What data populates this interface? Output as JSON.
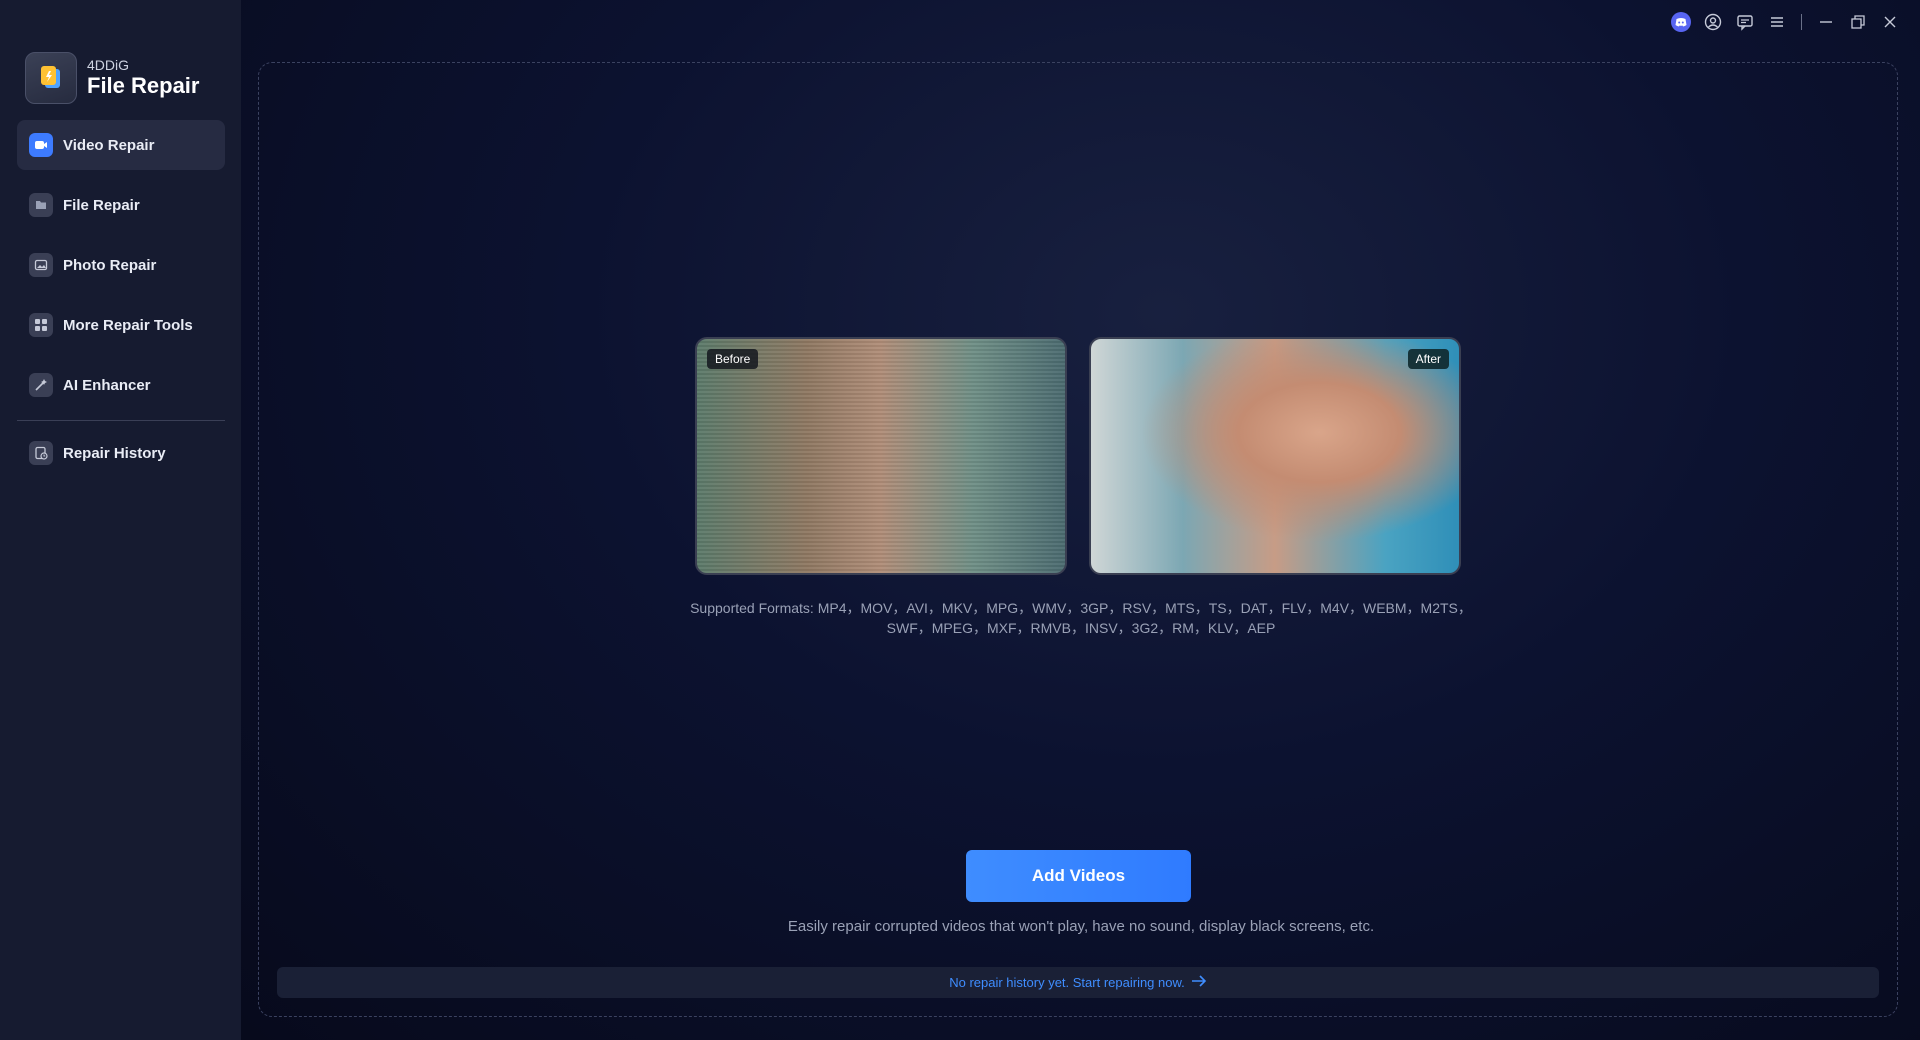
{
  "brand": {
    "company": "4DDiG",
    "product": "File Repair"
  },
  "sidebar": {
    "items": [
      {
        "label": "Video Repair",
        "icon": "video-icon",
        "active": true
      },
      {
        "label": "File Repair",
        "icon": "file-icon",
        "active": false
      },
      {
        "label": "Photo Repair",
        "icon": "photo-icon",
        "active": false
      },
      {
        "label": "More Repair Tools",
        "icon": "grid-icon",
        "active": false
      },
      {
        "label": "AI Enhancer",
        "icon": "magic-wand-icon",
        "active": false
      }
    ],
    "history": {
      "label": "Repair History",
      "icon": "history-icon"
    }
  },
  "titlebar": {
    "icons": [
      "discord-icon",
      "account-icon",
      "feedback-icon",
      "menu-icon",
      "minimize-icon",
      "restore-icon",
      "close-icon"
    ]
  },
  "preview": {
    "before_label": "Before",
    "after_label": "After"
  },
  "formats": {
    "prefix": "Supported Formats:",
    "line1": "MP4，MOV，AVI，MKV，MPG，WMV，3GP，RSV，MTS，TS，DAT，FLV，M4V，WEBM，M2TS，",
    "line2": "SWF，MPEG，MXF，RMVB，INSV，3G2，RM，KLV，AEP"
  },
  "main": {
    "add_button": "Add Videos",
    "hint": "Easily repair corrupted videos that won't play, have no sound, display black screens, etc.",
    "history_link": "No repair history yet. Start repairing now."
  },
  "colors": {
    "accent": "#3f8dff",
    "sidebar_bg": "#161b30",
    "main_bg": "#0c1230"
  }
}
